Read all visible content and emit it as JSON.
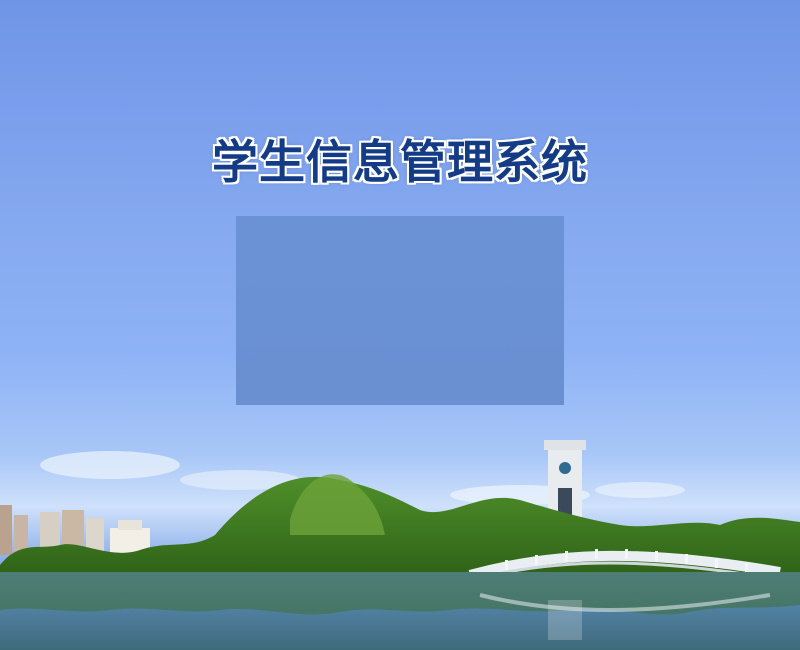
{
  "app": {
    "title": "学生信息管理系统"
  },
  "colors": {
    "title_text": "#143b86",
    "panel_bg": "#678ed0",
    "sky_top": "#6f95e7",
    "sky_bottom": "#a8c7f7"
  },
  "background": {
    "icon": "campus-lake-scenery-icon"
  }
}
